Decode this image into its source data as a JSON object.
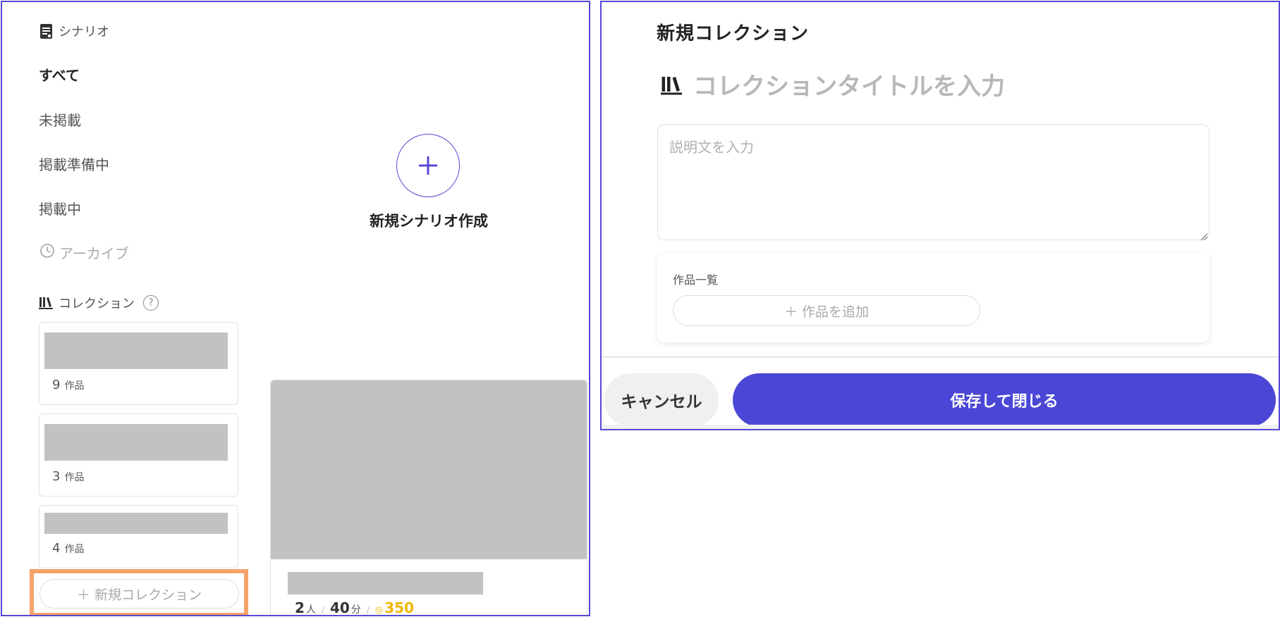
{
  "sidebar": {
    "scenario_heading": "シナリオ",
    "nav": [
      {
        "label": "すべて"
      },
      {
        "label": "未掲載"
      },
      {
        "label": "掲載準備中"
      },
      {
        "label": "掲載中"
      }
    ],
    "archive_label": "アーカイブ",
    "collection_heading": "コレクション",
    "help_glyph": "?",
    "collections": [
      {
        "count": "9",
        "unit": "作品"
      },
      {
        "count": "3",
        "unit": "作品"
      },
      {
        "count": "4",
        "unit": "作品"
      }
    ],
    "new_collection_label": "新規コレクション"
  },
  "main": {
    "create_scenario_label": "新規シナリオ作成",
    "scenario_card": {
      "players": "2",
      "players_unit": "人",
      "duration": "40",
      "duration_unit": "分",
      "separator": "/",
      "price": "350"
    }
  },
  "modal": {
    "title": "新規コレクション",
    "title_placeholder": "コレクションタイトルを入力",
    "description_placeholder": "説明文を入力",
    "works_label": "作品一覧",
    "add_work_label": "作品を追加",
    "cancel_label": "キャンセル",
    "save_label": "保存して閉じる"
  },
  "colors": {
    "accent": "#4a47d6",
    "highlight": "#f4a36a",
    "coin": "#f2b705"
  }
}
